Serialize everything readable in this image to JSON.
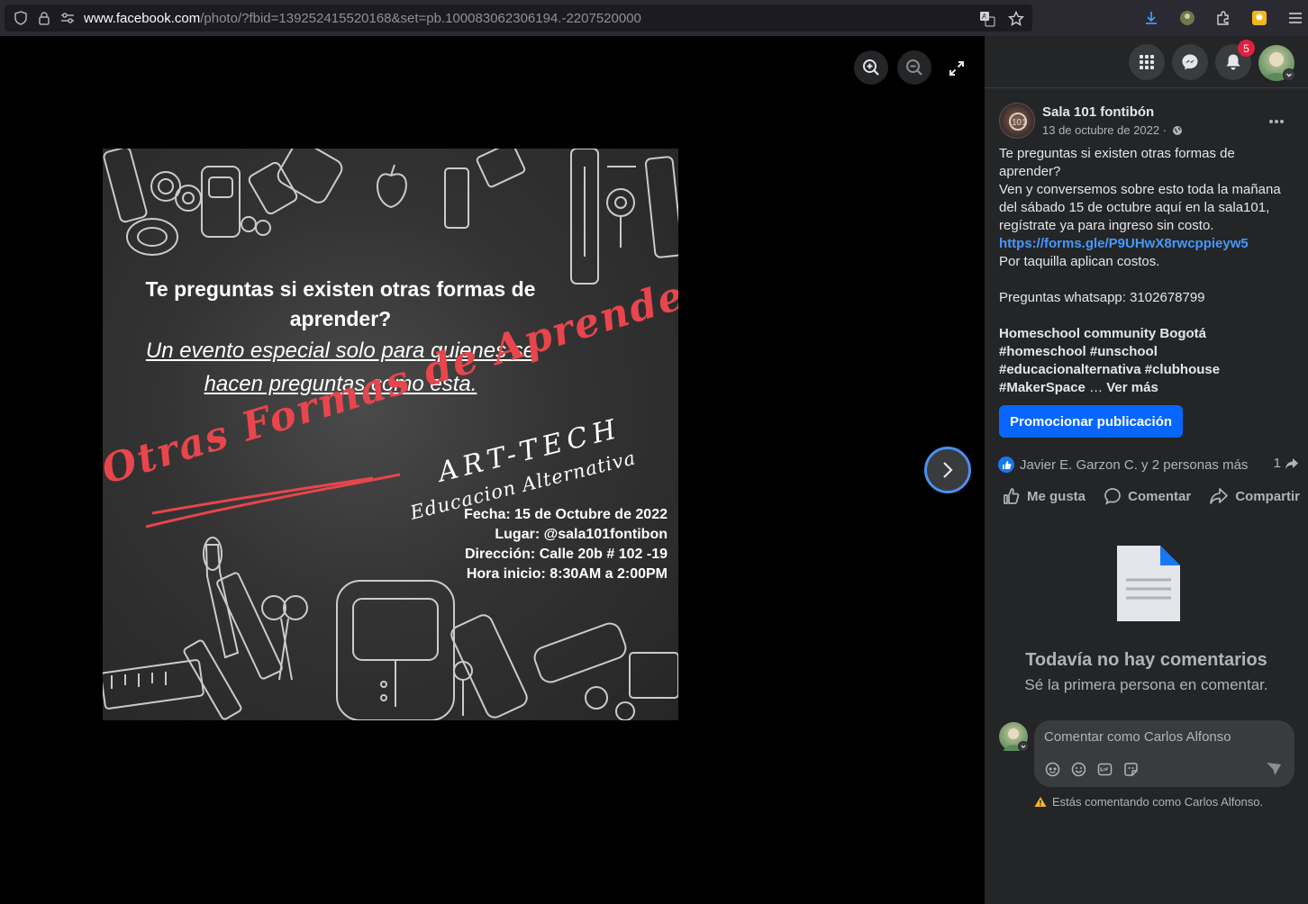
{
  "browser": {
    "url_domain": "www.facebook.com",
    "url_path": "/photo/?fbid=139252415520168&set=pb.100083062306194.-2207520000"
  },
  "poster": {
    "question": "Te preguntas si existen otras formas de aprender?",
    "subtitle": "Un evento especial solo para quienes se hacen preguntas como esta.",
    "script_title": "Otras Formas de Aprender",
    "brand": "ART-TECH",
    "brand_sub": "Educacion Alternativa",
    "info": [
      "Fecha: 15 de Octubre de 2022",
      "Lugar: @sala101fontibon",
      "Dirección: Calle 20b # 102 -19",
      "Hora inicio: 8:30AM a 2:00PM"
    ]
  },
  "header": {
    "notification_count": "5"
  },
  "post": {
    "page_name": "Sala 101 fontibón",
    "date": "13 de octubre de 2022 ·",
    "text_1": "Te preguntas si existen otras formas de aprender?",
    "text_2": "Ven y conversemos sobre esto toda la mañana del sábado 15 de octubre aquí en la sala101, regístrate ya para ingreso sin costo. ",
    "link": "https://forms.gle/P9UHwX8rwcppieyw5",
    "text_3": "Por taquilla aplican costos.",
    "text_4": "Preguntas whatsapp: 3102678799",
    "hashtags": "Homeschool community Bogotá #homeschool #unschool #educacionalternativa #clubhouse #MakerSpace",
    "ellipsis": " … ",
    "see_more": "Ver más",
    "promote_label": "Promocionar publicación"
  },
  "reactions": {
    "summary": "Javier E. Garzon C. y 2 personas más",
    "shares": "1"
  },
  "actions": {
    "like": "Me gusta",
    "comment": "Comentar",
    "share": "Compartir"
  },
  "comments": {
    "empty_title": "Todavía no hay comentarios",
    "empty_sub": "Sé la primera persona en comentar.",
    "input_placeholder": "Comentar como Carlos Alfonso",
    "notice": "Estás comentando como Carlos Alfonso."
  }
}
